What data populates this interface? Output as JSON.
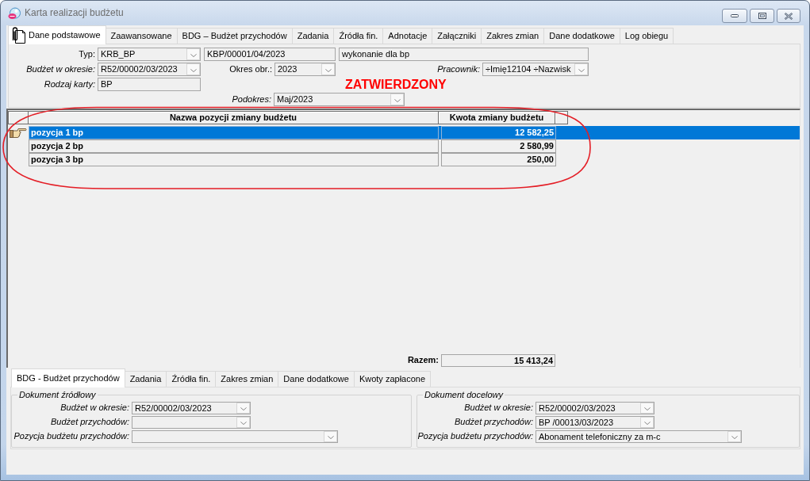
{
  "window": {
    "title": "Karta realizacji budżetu"
  },
  "tabs": [
    {
      "label": "Dane podstawowe",
      "selected": true
    },
    {
      "label": "Zaawansowane",
      "selected": false
    },
    {
      "label": "BDG – Budżet przychodów",
      "selected": false
    },
    {
      "label": "Zadania",
      "selected": false
    },
    {
      "label": "Źródła fin.",
      "selected": false
    },
    {
      "label": "Adnotacje",
      "selected": false
    },
    {
      "label": "Załączniki",
      "selected": false
    },
    {
      "label": "Zakres zmian",
      "selected": false
    },
    {
      "label": "Dane dodatkowe",
      "selected": false
    },
    {
      "label": "Log obiegu",
      "selected": false
    }
  ],
  "form": {
    "type": {
      "label": "Typ:",
      "value": "KRB_BP"
    },
    "number": {
      "value": "KBP/00001/04/2023"
    },
    "description": {
      "value": "wykonanie dla bp"
    },
    "budget_in_period": {
      "label": "Budżet w okresie:",
      "value": "R52/00002/03/2023"
    },
    "fiscal_period": {
      "label": "Okres obr.:",
      "value": "2023"
    },
    "employee": {
      "label": "Pracownik:",
      "value": "÷Imię12104 ÷Nazwisk"
    },
    "card_kind": {
      "label": "Rodzaj karty:",
      "value": "BP"
    },
    "status": "ZATWIERDZONY",
    "subperiod": {
      "label": "Podokres:",
      "value": "Maj/2023"
    }
  },
  "table": {
    "columns": [
      "Nazwa pozycji zmiany budżetu",
      "Kwota zmiany budżetu"
    ],
    "rows": [
      {
        "cells": [
          "pozycja 1 bp",
          "12 582,25"
        ],
        "selected": true
      },
      {
        "cells": [
          "pozycja 2 bp",
          "2 580,99"
        ],
        "selected": false
      },
      {
        "cells": [
          "pozycja 3 bp",
          "250,00"
        ],
        "selected": false
      }
    ],
    "total": {
      "label": "Razem:",
      "value": "15 413,24"
    }
  },
  "annotations": [
    {
      "kind": "ellipse"
    }
  ],
  "bottom_tabs": [
    {
      "label": "BDG - Budżet przychodów",
      "selected": true
    },
    {
      "label": "Zadania",
      "selected": false
    },
    {
      "label": "Źródła fin.",
      "selected": false
    },
    {
      "label": "Zakres zmian",
      "selected": false
    },
    {
      "label": "Dane dodatkowe",
      "selected": false
    },
    {
      "label": "Kwoty zapłacone",
      "selected": false
    }
  ],
  "groups": [
    {
      "title": "Dokument źródłowy",
      "fields": [
        {
          "label": "Budżet w okresie:",
          "value": "R52/00002/03/2023"
        },
        {
          "label": "Budżet przychodów:"
        },
        {
          "label": "Pozycja budżetu przychodów:"
        }
      ]
    },
    {
      "title": "Dokument docelowy",
      "fields": [
        {
          "label": "Budżet w okresie:",
          "value": "R52/00002/03/2023"
        },
        {
          "label": "Budżet przychodów:",
          "value": "BP /00013/03/2023"
        },
        {
          "label": "Pozycja budżetu przychodów:",
          "value": "Abonament telefoniczny za m-c"
        }
      ]
    }
  ]
}
